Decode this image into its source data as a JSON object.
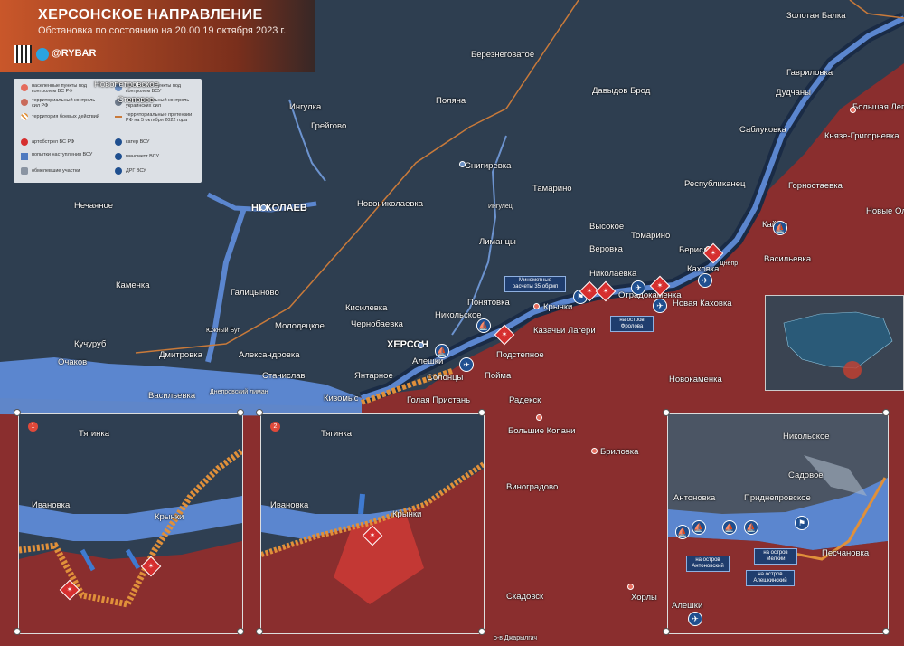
{
  "header": {
    "title": "ХЕРСОНСКОЕ НАПРАВЛЕНИЕ",
    "subtitle": "Обстановка по состоянию на 20.00 19 октября 2023 г.",
    "handle": "@RYBAR"
  },
  "legend": {
    "items": [
      "населенные пункты под контролем ВС РФ",
      "населенные пункты под контролем ВСУ",
      "территориальный контроль сил РФ",
      "территориальный контроль украинских сил",
      "территория боевых действий",
      "территориальные претензии РФ на 5 октября 2022 года",
      "артобстрел ВС РФ",
      "катер ВСУ",
      "попытки наступления ВСУ",
      "минометт ВСУ",
      "обмелевшие участки",
      "ДРГ ВСУ"
    ]
  },
  "cities": [
    "Новопетровское",
    "Ингулка",
    "Грейгово",
    "Поляна",
    "Березнеговатое",
    "Давыдов Брод",
    "Золотая Балка",
    "Гавриловка",
    "Дудчаны",
    "Большая Лепетиха",
    "Саблуковка",
    "Князе-Григорьевка",
    "Снигиревка",
    "Тамарино",
    "Республиканец",
    "Горностаевка",
    "Нечаяное",
    "НИКОЛАЕВ",
    "Новониколаевка",
    "Ингулец",
    "Высокое",
    "Веровка",
    "Томарино",
    "Лиманцы",
    "Кайры",
    "Новые Олешки",
    "Берислав",
    "Каховка",
    "Васильевка",
    "Николаевка",
    "Отрадокаменка",
    "Новая Каховка",
    "Каменка",
    "Галицыново",
    "Кисилевка",
    "Понятовка",
    "Никольское",
    "Крынки",
    "Молодецкое",
    "Чернобаевка",
    "Казачьи Лагери",
    "ХЕРСОН",
    "Кучуруб",
    "Очаков",
    "Дмитровка",
    "Александровка",
    "Алешки",
    "Подстепное",
    "Солонцы",
    "Станислав",
    "Янтарное",
    "Пойма",
    "Новокаменка",
    "Кизомыс",
    "Голая Пристань",
    "Радекск",
    "Большие Копани",
    "Бриловка",
    "Виноградово",
    "Скадовск",
    "Хорлы",
    "Васильевка",
    "Степовое",
    "Днепр",
    "Днепровский лиман",
    "Южный Буг"
  ],
  "callouts": {
    "mortar": "Минометные расчеты 35 обрмп",
    "frolova": "на остров Фролова"
  },
  "insets": [
    {
      "num": "1",
      "labels": [
        "Тягинка",
        "Ивановка",
        "Крынки"
      ]
    },
    {
      "num": "2",
      "labels": [
        "Тягинка",
        "Ивановка",
        "Крынки"
      ]
    },
    {
      "num": "",
      "labels": [
        "Никольское",
        "Садовое",
        "Антоновка",
        "Приднепровское",
        "Песчановка",
        "Алешки",
        "на остров Антоновский",
        "на остров Мелкий",
        "на остров Алешкинский"
      ]
    }
  ],
  "bottom_label": "о-в Джарылгач",
  "colors": {
    "ru": "#8a2e2e",
    "ua": "#2d3d4f",
    "water": "#5b86cf",
    "combat": "#e0903a",
    "front": "#c97a3a"
  }
}
